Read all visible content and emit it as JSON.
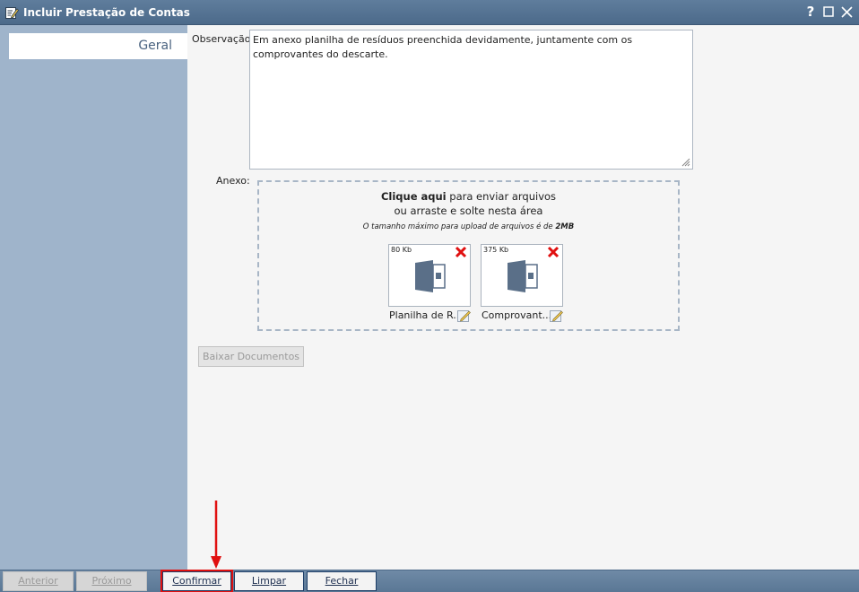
{
  "window": {
    "title": "Incluir Prestação de Contas",
    "help_label": "?"
  },
  "sidebar": {
    "tabs": [
      {
        "label": "Geral",
        "selected": true
      }
    ]
  },
  "form": {
    "observacao_label": "Observação:",
    "observacao_value": "Em anexo planilha de resíduos preenchida devidamente, juntamente com os comprovantes do descarte.",
    "anexo_label": "Anexo:",
    "dropzone": {
      "click_text": "Clique aqui",
      "line1_rest": " para enviar arquivos",
      "line2": "ou arraste e solte nesta área",
      "note_prefix": "O tamanho máximo para upload de arquivos é de ",
      "note_size": "2MB"
    },
    "files": [
      {
        "size": "80 Kb",
        "name": "Planilha de R..."
      },
      {
        "size": "375 Kb",
        "name": "Comprovant..."
      }
    ],
    "download_button": "Baixar Documentos"
  },
  "footer": {
    "buttons": [
      {
        "label": "Anterior",
        "enabled": false
      },
      {
        "label": "Próximo",
        "enabled": false
      },
      {
        "label": "Confirmar",
        "enabled": true,
        "highlighted": true
      },
      {
        "label": "Limpar",
        "enabled": true
      },
      {
        "label": "Fechar",
        "enabled": true
      }
    ]
  },
  "colors": {
    "titlebar": "#4c6a8a",
    "sidebar": "#9fb4cb",
    "highlight_outline": "#e01010",
    "delete_icon": "#e01010"
  }
}
